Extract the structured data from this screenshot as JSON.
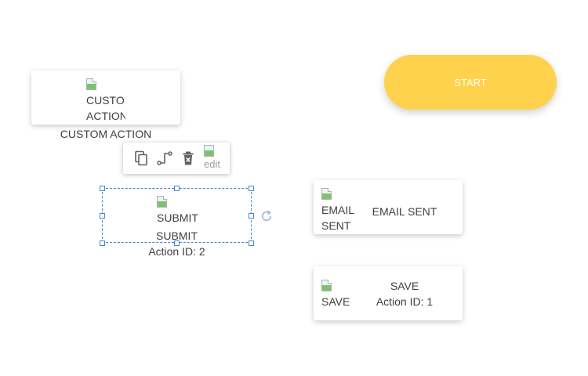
{
  "nodes": {
    "start": {
      "label": "START"
    },
    "custom_action": {
      "icon_alt": "CUSTOM ACTION",
      "icon_alt_line1": "CUSTOM",
      "icon_alt_line2": "ACTION",
      "caption": "CUSTOM ACTION"
    },
    "submit": {
      "icon_alt": "SUBMIT",
      "label": "SUBMIT",
      "action_id": "Action ID: 2"
    },
    "email_sent": {
      "icon_alt": "EMAIL SENT",
      "icon_alt_line1": "EMAIL",
      "icon_alt_line2": "SENT",
      "label": "EMAIL SENT"
    },
    "save": {
      "icon_alt": "SAVE",
      "label": "SAVE",
      "action_id": "Action ID: 1"
    }
  },
  "toolbar": {
    "duplicate_icon": "copy-icon",
    "connect_icon": "connector-icon",
    "delete_icon": "delete-icon",
    "edit_icon_alt": "edit"
  },
  "colors": {
    "start_fill": "#ffd24d",
    "selection": "#4a86c5",
    "text": "#404040"
  }
}
